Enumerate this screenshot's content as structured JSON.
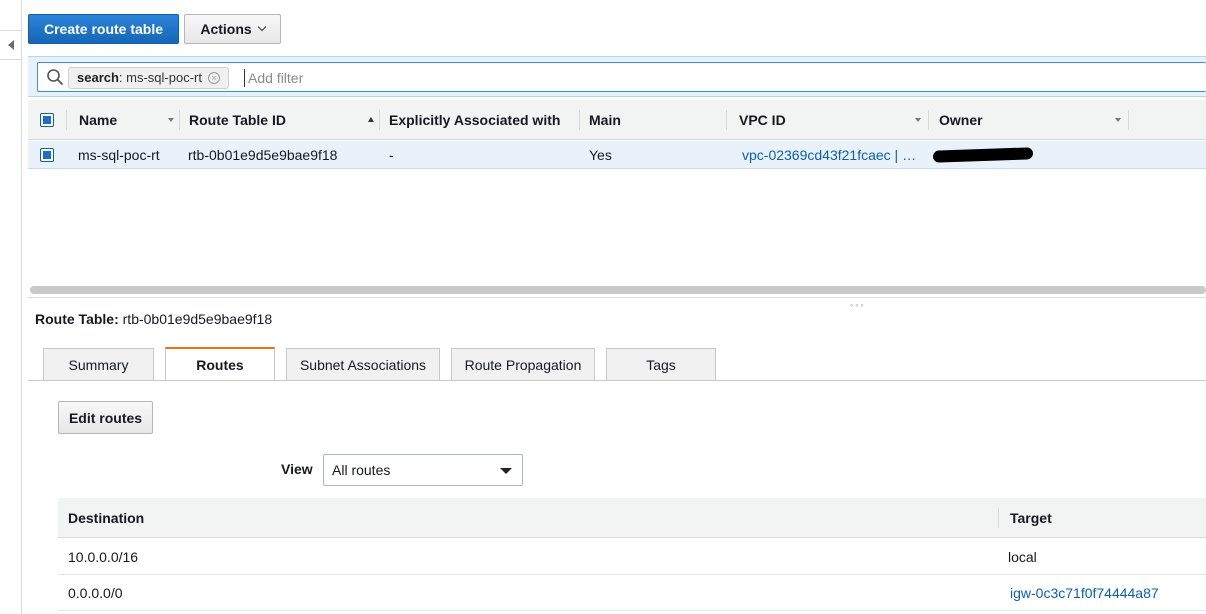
{
  "toolbar": {
    "create_label": "Create route table",
    "actions_label": "Actions"
  },
  "filter": {
    "token_key": "search",
    "token_value": ": ms-sql-poc-rt",
    "placeholder": "Add filter"
  },
  "grid": {
    "columns": [
      "Name",
      "Route Table ID",
      "Explicitly Associated with",
      "Main",
      "VPC ID",
      "Owner"
    ],
    "rows": [
      {
        "name": "ms-sql-poc-rt",
        "route_table_id": "rtb-0b01e9d5e9bae9f18",
        "explicitly_associated": "-",
        "main": "Yes",
        "vpc_id": "vpc-02369cd43f21fcaec | …",
        "owner": "",
        "selected": true
      }
    ]
  },
  "detail": {
    "label": "Route Table:",
    "value": "rtb-0b01e9d5e9bae9f18",
    "tabs": [
      "Summary",
      "Routes",
      "Subnet Associations",
      "Route Propagation",
      "Tags"
    ],
    "active_tab": "Routes",
    "edit_label": "Edit routes",
    "view_label": "View",
    "view_value": "All routes",
    "route_columns": [
      "Destination",
      "Target"
    ],
    "routes": [
      {
        "destination": "10.0.0.0/16",
        "target": "local"
      },
      {
        "destination": "0.0.0.0/0",
        "target": "igw-0c3c71f0f74444a87"
      }
    ]
  },
  "colors": {
    "primary": "#1566b7",
    "selected_row": "#e9f2fb",
    "active_tab_accent": "#ec7211",
    "link": "#0b5fae"
  }
}
